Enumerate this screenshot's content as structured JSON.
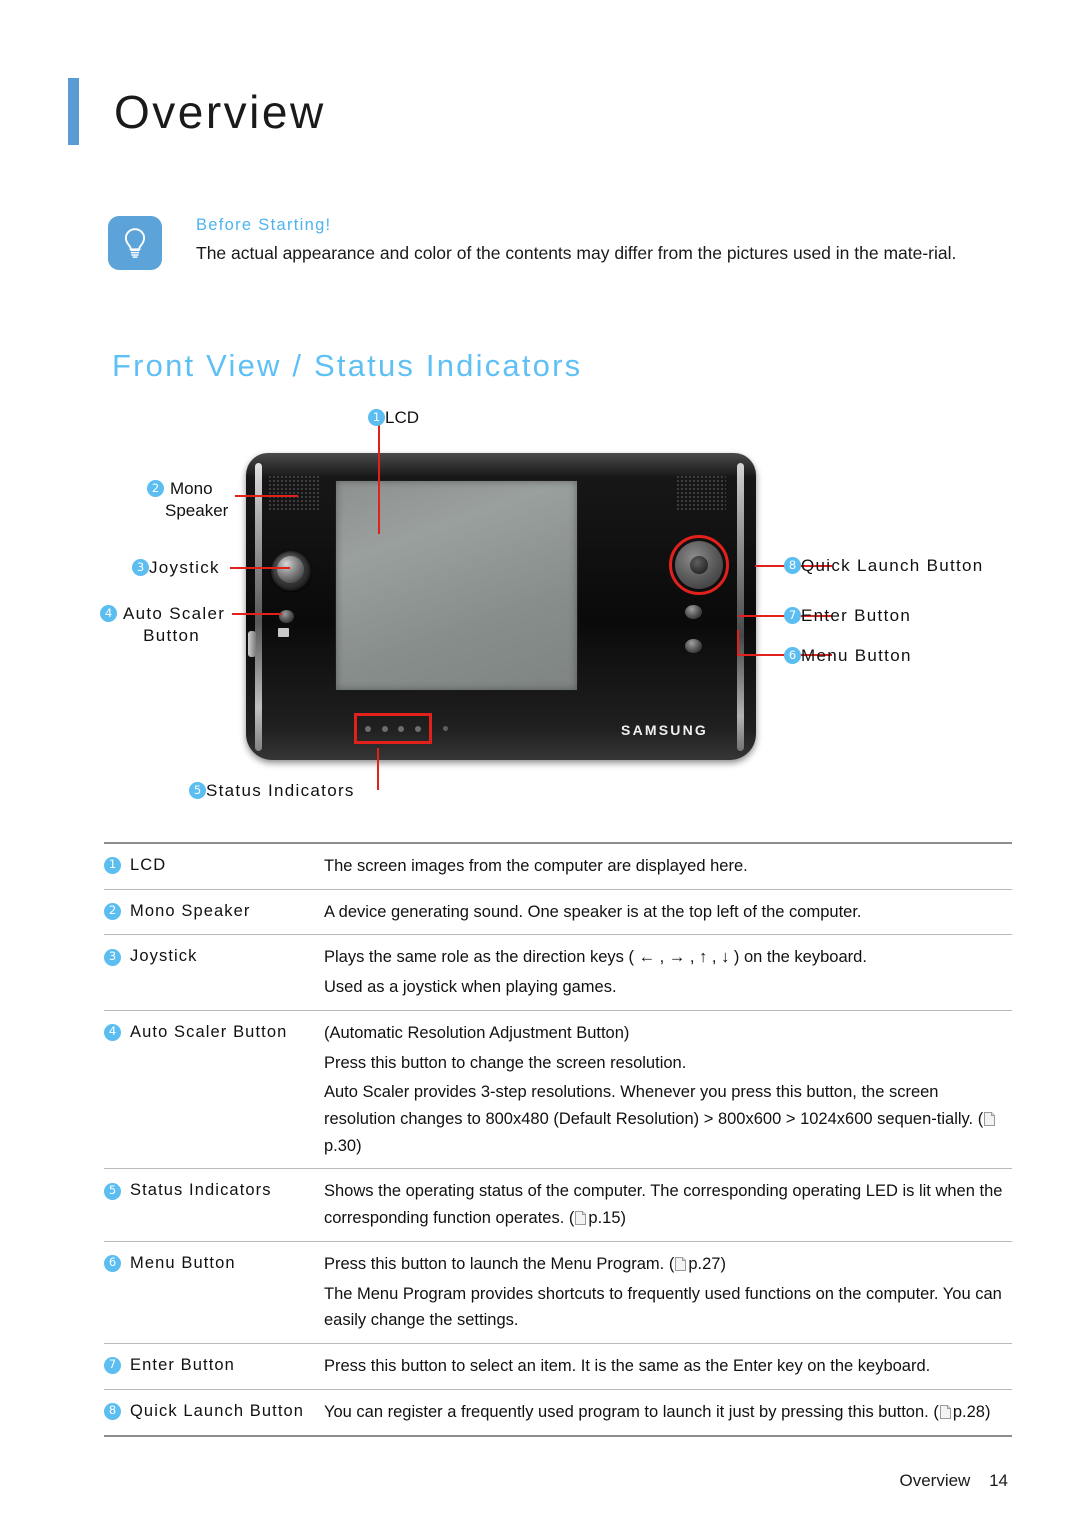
{
  "page": {
    "title": "Overview",
    "accent_blue": "#5b9bd5",
    "heading_blue": "#5fc0f5",
    "callout_red": "#e2211c"
  },
  "note": {
    "icon": "lightbulb-icon",
    "heading": "Before Starting!",
    "body": "The actual appearance and color of the contents may differ from the pictures used in the mate-rial."
  },
  "section": {
    "heading": "Front View / Status Indicators"
  },
  "figure": {
    "device_logo": "SAMSUNG",
    "callouts": [
      {
        "num": "1",
        "label": "LCD"
      },
      {
        "num": "2",
        "label": "Mono",
        "label2": "Speaker"
      },
      {
        "num": "3",
        "label": "Joystick"
      },
      {
        "num": "4",
        "label": "Auto Scaler",
        "label2": "Button"
      },
      {
        "num": "5",
        "label": "Status Indicators"
      },
      {
        "num": "6",
        "label": "Menu Button"
      },
      {
        "num": "7",
        "label": "Enter Button"
      },
      {
        "num": "8",
        "label": "Quick Launch Button"
      }
    ]
  },
  "table": {
    "rows": [
      {
        "num": "1",
        "name": "LCD",
        "lines": [
          {
            "text": "The screen images from the computer are displayed here."
          }
        ]
      },
      {
        "num": "2",
        "name": "Mono Speaker",
        "lines": [
          {
            "text": "A device generating sound. One speaker is at the top left of the computer."
          }
        ]
      },
      {
        "num": "3",
        "name": "Joystick",
        "lines": [
          {
            "text": "Plays the same role as the direction keys ( ← , → , ↑ , ↓ ) on the keyboard."
          },
          {
            "text": "Used as a joystick when playing games."
          }
        ]
      },
      {
        "num": "4",
        "name": "Auto Scaler Button",
        "lines": [
          {
            "text": "(Automatic Resolution Adjustment Button)"
          },
          {
            "text": "Press this button to change the screen resolution."
          },
          {
            "text": "Auto Scaler provides 3-step resolutions. Whenever you press this button, the screen resolution changes to 800x480 (Default Resolution) > 800x600 > 1024x600 sequen-tially. (",
            "ref": "p.30",
            "tail": ")"
          }
        ]
      },
      {
        "num": "5",
        "name": "Status Indicators",
        "lines": [
          {
            "text": "Shows the operating status of the computer. The corresponding operating LED is lit when the corresponding function operates. (",
            "ref": "p.15",
            "tail": ")"
          }
        ]
      },
      {
        "num": "6",
        "name": "Menu Button",
        "lines": [
          {
            "text": "Press this button to launch the Menu Program. (",
            "ref": "p.27",
            "tail": ")"
          },
          {
            "text": "The Menu Program provides shortcuts to frequently used functions on the computer. You can easily change the settings."
          }
        ]
      },
      {
        "num": "7",
        "name": "Enter Button",
        "lines": [
          {
            "text": "Press this button to select an item. It is the same as the Enter key on the keyboard."
          }
        ]
      },
      {
        "num": "8",
        "name": "Quick Launch Button",
        "lines": [
          {
            "text": "You can register a frequently used program to launch it just by pressing this button. (",
            "ref": "p.28",
            "tail": ")"
          }
        ]
      }
    ]
  },
  "footer": {
    "label": "Overview",
    "page_number": "14"
  }
}
